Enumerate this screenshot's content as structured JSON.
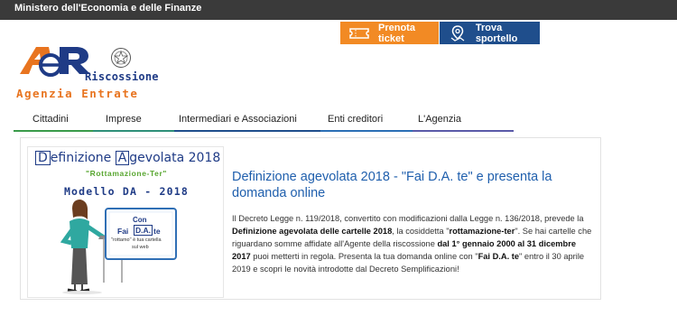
{
  "header": {
    "ministry_label": "Ministero dell'Economia e delle Finanze"
  },
  "quick_actions": {
    "prenota": {
      "label": "Prenota ticket",
      "icon": "ticket-icon"
    },
    "trova": {
      "label": "Trova sportello",
      "icon": "map-pin-icon"
    }
  },
  "logo": {
    "brand_text": "Riscossione",
    "agency_text": "Agenzia Entrate",
    "logo_mark": "aeR"
  },
  "nav": {
    "items": [
      {
        "label": "Cittadini",
        "color": "#3a9b4a"
      },
      {
        "label": "Imprese",
        "color": "#2e8f78"
      },
      {
        "label": "Intermediari e Associazioni",
        "color": "#1f4e8c"
      },
      {
        "label": "Enti creditori",
        "color": "#2a6fb5"
      },
      {
        "label": "L'Agenzia",
        "color": "#5a5aa8"
      }
    ]
  },
  "article": {
    "image": {
      "title_d": "D",
      "title_efinizione": "efinizione ",
      "title_a": "A",
      "title_gevolata": "gevolata 2018",
      "subtitle": "\"Rottamazione-Ter\"",
      "model": "Modello  DA - 2018",
      "screen_con": "Con",
      "screen_fai": "Fai",
      "screen_da": "D.A.",
      "screen_te": "te",
      "screen_rottamo": "\"rottamo\" è tua cartella",
      "screen_web": "sul web"
    },
    "headline": "Definizione agevolata 2018 - \"Fai D.A. te\" e presenta la domanda online",
    "body": {
      "p1": "Il Decreto Legge n. 119/2018, convertito con modificazioni dalla Legge n. 136/2018, prevede la ",
      "b1": "Definizione agevolata delle cartelle 2018",
      "p2": ", la cosiddetta \"",
      "b2": "rottamazione-ter",
      "p3": "\". Se hai cartelle che riguardano somme affidate all'Agente della riscossione ",
      "b3": "dal 1° gennaio 2000 al 31 dicembre 2017",
      "p4": " puoi metterti in regola. Presenta la tua domanda online con \"",
      "b4": "Fai D.A. te",
      "p5": "\" entro il 30 aprile 2019 e scopri le novità introdotte dal Decreto Semplificazioni!"
    }
  },
  "colors": {
    "topbar": "#3a3a3a",
    "ticket_orange": "#f28a24",
    "sportello_blue": "#1f4e8c",
    "headline_blue": "#1f5fad"
  }
}
